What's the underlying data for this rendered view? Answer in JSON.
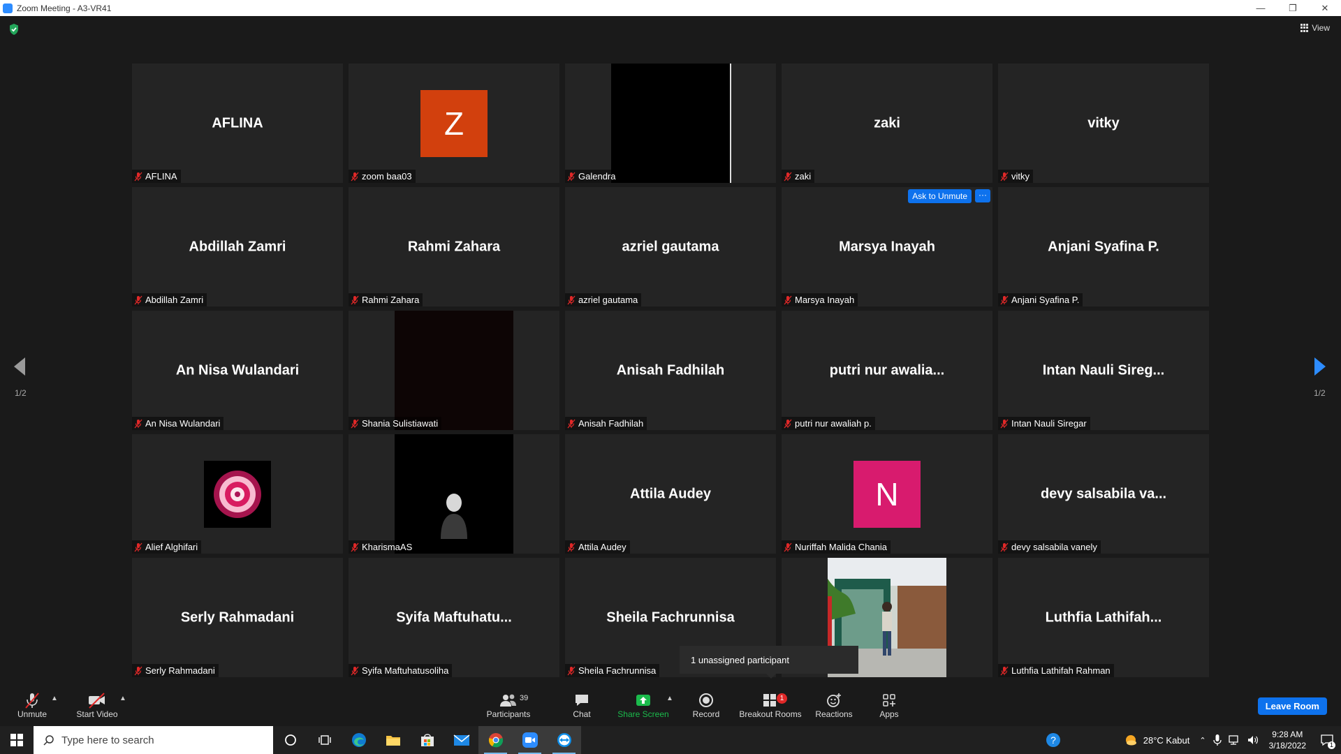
{
  "window": {
    "title": "Zoom Meeting - A3-VR41"
  },
  "header": {
    "view_label": "View"
  },
  "pager": {
    "left_indicator": "1/2",
    "right_indicator": "1/2"
  },
  "tiles": [
    {
      "center_text": "AFLINA",
      "label": "AFLINA"
    },
    {
      "avatar_letter": "Z",
      "avatar_color": "#d2400d",
      "label": "zoom baa03"
    },
    {
      "label": "Galendra"
    },
    {
      "center_text": "zaki",
      "label": "zaki"
    },
    {
      "center_text": "vitky",
      "label": "vitky"
    },
    {
      "center_text": "Abdillah Zamri",
      "label": "Abdillah Zamri"
    },
    {
      "center_text": "Rahmi Zahara",
      "label": "Rahmi Zahara"
    },
    {
      "center_text": "azriel gautama",
      "label": "azriel gautama"
    },
    {
      "center_text": "Marsya Inayah",
      "label": "Marsya Inayah",
      "ask_to_unmute": "Ask to Unmute",
      "more": "···"
    },
    {
      "center_text": "Anjani Syafina P.",
      "label": "Anjani Syafina P."
    },
    {
      "center_text": "An Nisa Wulandari",
      "label": "An Nisa Wulandari"
    },
    {
      "label": "Shania Sulistiawati"
    },
    {
      "center_text": "Anisah Fadhilah",
      "label": "Anisah Fadhilah"
    },
    {
      "center_text": "putri nur awalia...",
      "label": "putri nur awaliah p."
    },
    {
      "center_text": "Intan Nauli Sireg...",
      "label": "Intan Nauli Siregar"
    },
    {
      "label": "Alief Alghifari"
    },
    {
      "label": "KharismaAS"
    },
    {
      "center_text": "Attila Audey",
      "label": "Attila Audey"
    },
    {
      "avatar_letter": "N",
      "avatar_color": "#d81b6e",
      "label": "Nuriffah Malida Chania"
    },
    {
      "center_text": "devy salsabila va...",
      "label": "devy salsabila vanely"
    },
    {
      "center_text": "Serly Rahmadani",
      "label": "Serly Rahmadani"
    },
    {
      "center_text": "Syifa  Maftuhatu...",
      "label": "Syifa Maftuhatusoliha"
    },
    {
      "center_text": "Sheila Fachrunnisa",
      "label": "Sheila Fachrunnisa"
    },
    {},
    {
      "center_text": "Luthfia  Lathifah...",
      "label": "Luthfia Lathifah Rahman"
    }
  ],
  "tooltip": {
    "text": "1 unassigned participant"
  },
  "toolbar": {
    "unmute": "Unmute",
    "start_video": "Start Video",
    "participants": "Participants",
    "participant_count": "39",
    "chat": "Chat",
    "share_screen": "Share Screen",
    "record": "Record",
    "breakout_rooms": "Breakout Rooms",
    "breakout_badge": "1",
    "reactions": "Reactions",
    "apps": "Apps",
    "leave_room": "Leave Room",
    "share_color": "#1bbb4c",
    "accent_color": "#0e72ed"
  },
  "taskbar": {
    "search_placeholder": "Type here to search",
    "weather": "28°C  Kabut",
    "time": "9:28 AM",
    "date": "3/18/2022",
    "notification_count": "1"
  }
}
